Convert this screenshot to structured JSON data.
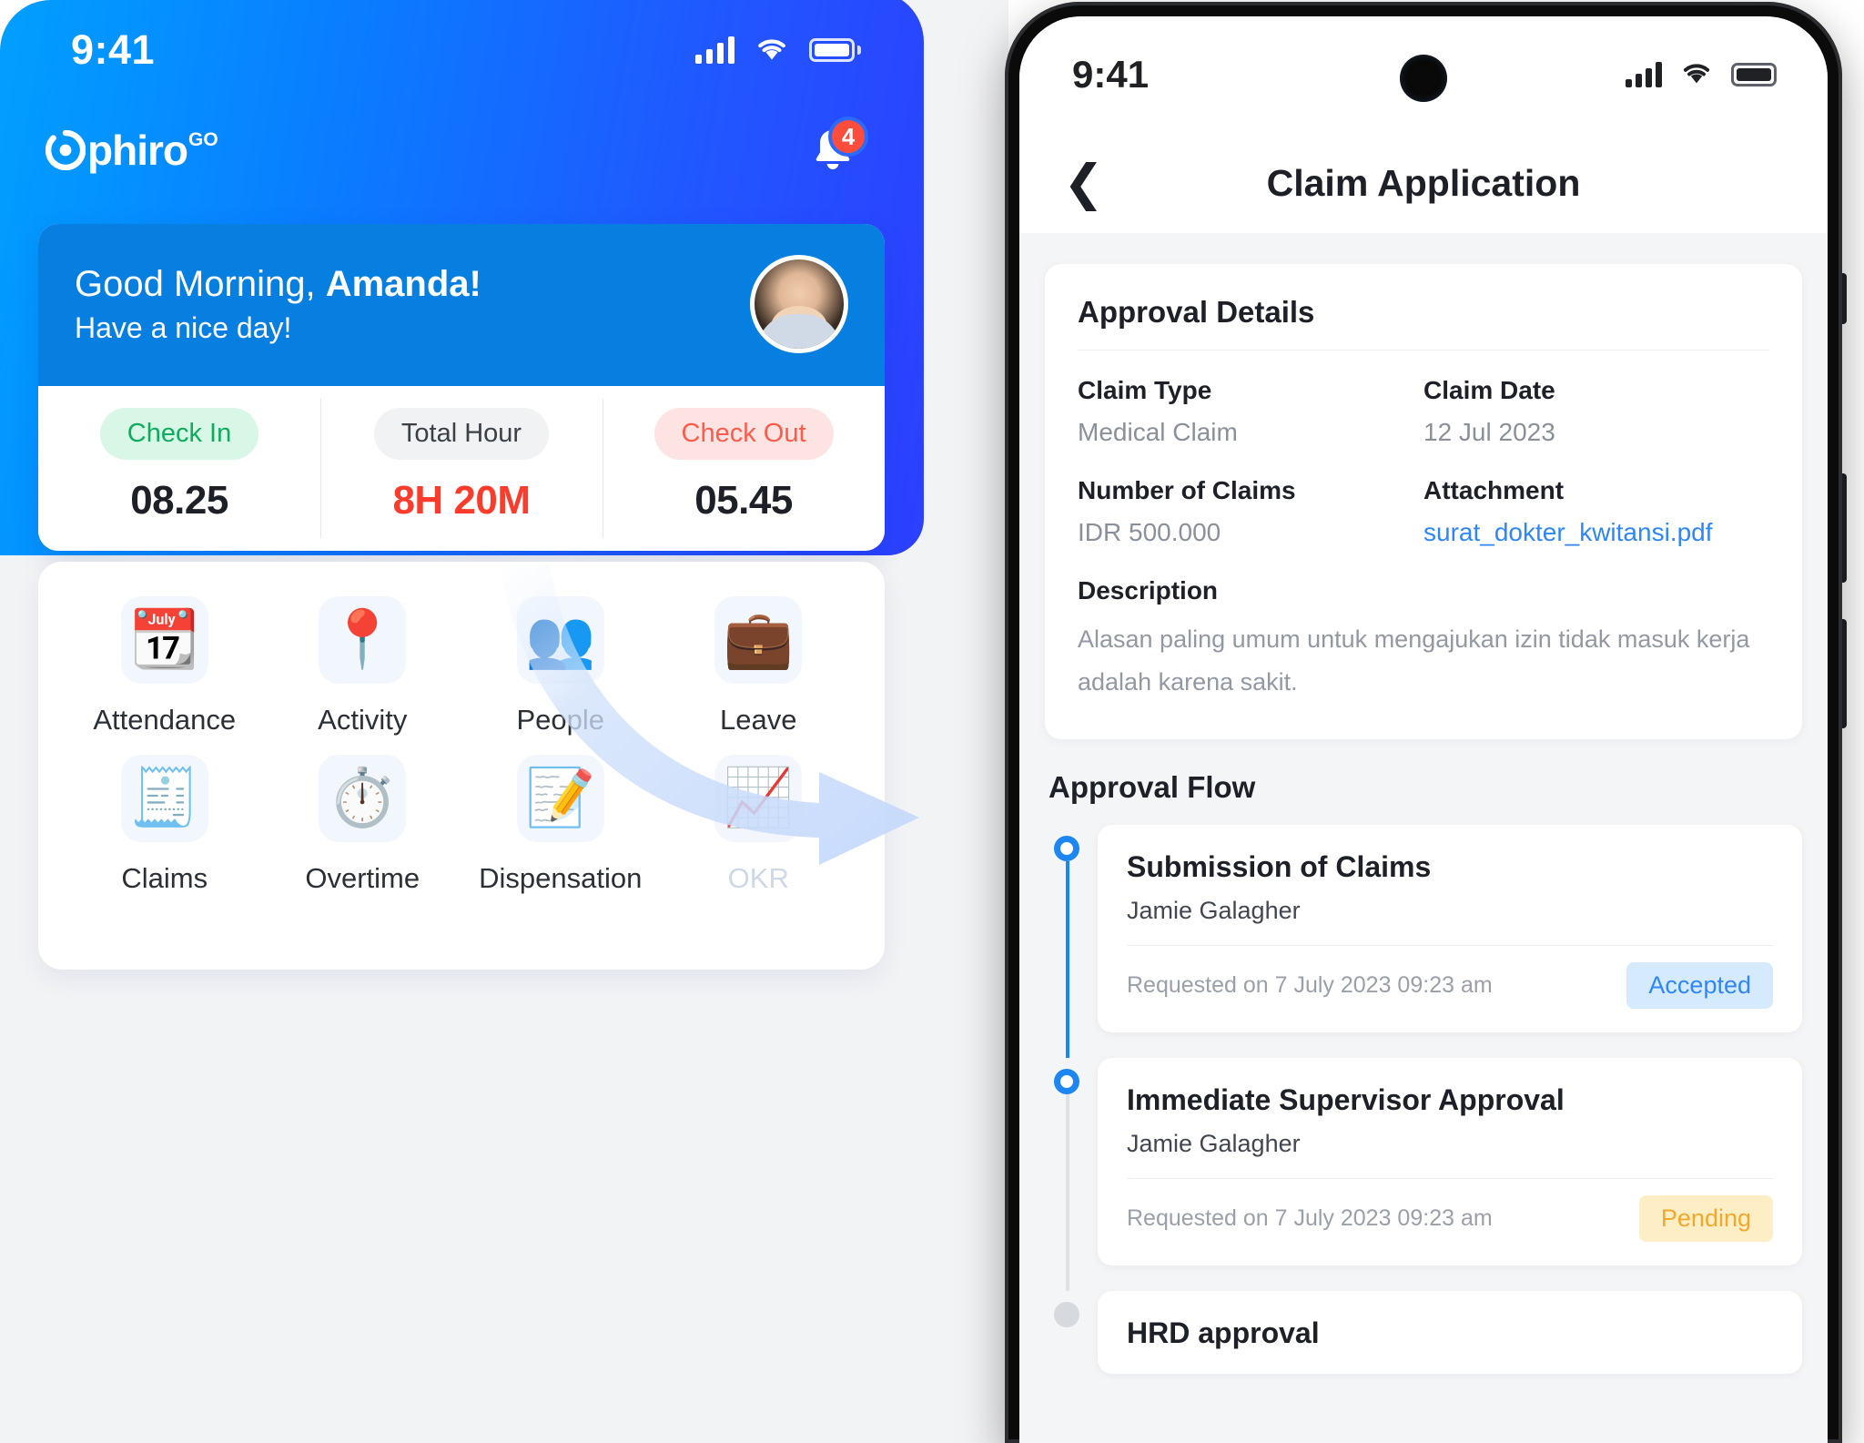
{
  "left_phone": {
    "status_bar": {
      "time": "9:41",
      "signal_icon": "cellular-signal-icon",
      "wifi_icon": "wifi-icon",
      "battery_icon": "battery-full-icon"
    },
    "brand": {
      "name": "phiro",
      "superscript": "GO",
      "logo_icon": "phiro-logo-icon"
    },
    "notification": {
      "icon": "bell-icon",
      "badge_count": "4"
    },
    "greeting": {
      "salutation_prefix": "Good Morning, ",
      "name": "Amanda!",
      "subtitle": "Have a nice day!",
      "avatar_icon": "user-avatar"
    },
    "attendance_stats": [
      {
        "label": "Check In",
        "value": "08.25",
        "style": "in"
      },
      {
        "label": "Total Hour",
        "value": "8H 20M",
        "style": "hour"
      },
      {
        "label": "Check Out",
        "value": "05.45",
        "style": "out"
      }
    ],
    "menu_items": [
      {
        "label": "Attendance",
        "icon": "calendar-clock-icon",
        "glyph": "📆",
        "faded": false
      },
      {
        "label": "Activity",
        "icon": "location-pin-icon",
        "glyph": "📍",
        "faded": false
      },
      {
        "label": "People",
        "icon": "people-icon",
        "glyph": "👥",
        "faded": false
      },
      {
        "label": "Leave",
        "icon": "suitcase-icon",
        "glyph": "💼",
        "faded": false
      },
      {
        "label": "Claims",
        "icon": "receipt-dollar-icon",
        "glyph": "🧾",
        "faded": false
      },
      {
        "label": "Overtime",
        "icon": "stopwatch-icon",
        "glyph": "⏱️",
        "faded": false
      },
      {
        "label": "Dispensation",
        "icon": "document-edit-icon",
        "glyph": "📝",
        "faded": false
      },
      {
        "label": "OKR",
        "icon": "growth-chart-icon",
        "glyph": "📈",
        "faded": true
      }
    ]
  },
  "right_phone": {
    "status_bar": {
      "time": "9:41",
      "camera_icon": "front-camera-punchhole",
      "signal_icon": "cellular-signal-icon",
      "wifi_icon": "wifi-icon",
      "battery_icon": "battery-full-icon"
    },
    "nav": {
      "back_icon": "chevron-left-icon",
      "title": "Claim Application"
    },
    "approval_details": {
      "heading": "Approval Details",
      "fields": [
        {
          "key": "Claim Type",
          "value": "Medical Claim",
          "type": "text"
        },
        {
          "key": "Claim Date",
          "value": "12 Jul 2023",
          "type": "text"
        },
        {
          "key": "Number of Claims",
          "value": "IDR 500.000",
          "type": "text"
        },
        {
          "key": "Attachment",
          "value": "surat_dokter_kwitansi.pdf",
          "type": "link"
        }
      ],
      "description_label": "Description",
      "description_text": "Alasan paling umum untuk mengajukan izin tidak masuk kerja adalah karena sakit."
    },
    "approval_flow": {
      "heading": "Approval Flow",
      "steps": [
        {
          "title": "Submission of Claims",
          "name": "Jamie Galagher",
          "requested": "Requested on 7 July 2023 09:23 am",
          "status": "Accepted",
          "status_style": "accepted",
          "dot": "active"
        },
        {
          "title": "Immediate Supervisor Approval",
          "name": "Jamie Galagher",
          "requested": "Requested on 7 July 2023 09:23 am",
          "status": "Pending",
          "status_style": "pending",
          "dot": "active"
        },
        {
          "title": "HRD approval",
          "name": "",
          "requested": "",
          "status": "",
          "status_style": "",
          "dot": "idle"
        }
      ]
    }
  },
  "decoration": {
    "arrow_icon": "curved-flow-arrow"
  },
  "colors": {
    "brand_gradient_start": "#00a3ff",
    "brand_gradient_end": "#2c3fff",
    "card_blue": "#077fe0",
    "accent_blue": "#2f86f7",
    "accepted_bg": "#d6eafe",
    "pending_bg": "#fdeec6",
    "pending_text": "#f0a92c",
    "check_in_text": "#0fab5e",
    "check_out_text": "#fb5c4c",
    "total_hour_value": "#fb3b2b",
    "badge_red": "#ff4d3d"
  }
}
